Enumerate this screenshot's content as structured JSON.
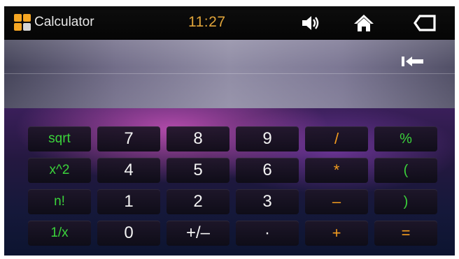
{
  "app": {
    "title": "Calculator"
  },
  "status": {
    "time": "11:27"
  },
  "display": {
    "value": ""
  },
  "keypad": {
    "rows": [
      [
        "sqrt",
        "7",
        "8",
        "9",
        "/",
        "%"
      ],
      [
        "x^2",
        "4",
        "5",
        "6",
        "*",
        "("
      ],
      [
        "n!",
        "1",
        "2",
        "3",
        "–",
        ")"
      ],
      [
        "1/x",
        "0",
        "+/–",
        "·",
        "+",
        "="
      ]
    ]
  },
  "icons": {
    "app": "calculator-app-icon",
    "volume": "speaker-icon",
    "home": "home-icon",
    "back": "back-icon",
    "backspace": "backspace-icon"
  },
  "colors": {
    "function_key_text": "#3bd33b",
    "operator_key_text": "#f39c1f",
    "digit_key_text": "#f2f2f2",
    "clock_text": "#e0a43a"
  }
}
